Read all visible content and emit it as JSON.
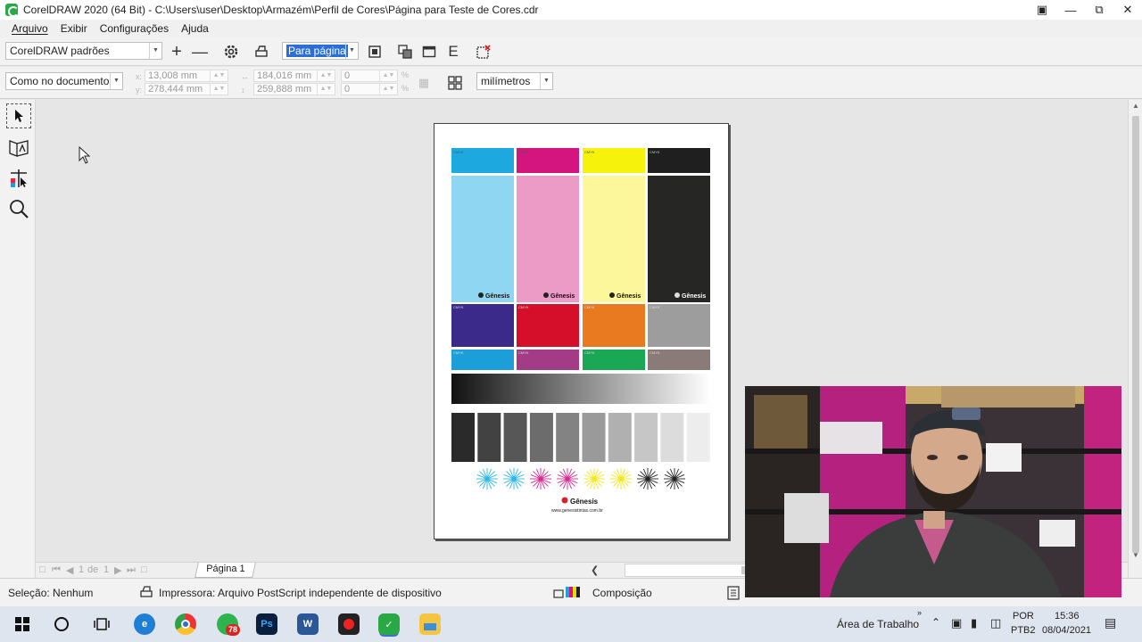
{
  "window": {
    "title": "CorelDRAW 2020 (64 Bit) - C:\\Users\\user\\Desktop\\Armazém\\Perfil de Cores\\Página para Teste de Cores.cdr",
    "controls": [
      "user-icon",
      "minimize-icon",
      "restore-icon",
      "close-icon"
    ]
  },
  "menu": [
    "Arquivo",
    "Exibir",
    "Configurações",
    "Ajuda"
  ],
  "toolbar": {
    "preset": "CorelDRAW padrões",
    "zoom": "Para página"
  },
  "propbar": {
    "document": "Como no documento",
    "x": "13,008 mm",
    "y": "278,444 mm",
    "width": "184,016 mm",
    "height": "259,888 mm",
    "scale_x": "0",
    "scale_y": "0",
    "units": "milímetros"
  },
  "tools": [
    "pick-tool-icon",
    "preview-icon",
    "layout-tool-icon",
    "zoom-tool-icon"
  ],
  "page_preview": {
    "cmyk_label": "CMYK",
    "brand": "Gênesis",
    "website": "www.genesistintas.com.br",
    "tall_strips": [
      {
        "top": "#1ea8e0",
        "body": "#8fd6f2"
      },
      {
        "top": "#d4157f",
        "body": "#ec9ac6"
      },
      {
        "top": "#f7f20c",
        "body": "#fbf79a"
      },
      {
        "top": "#1f1f1f",
        "body": "#262624"
      }
    ],
    "mid_squares": [
      "#3b2a8a",
      "#d50f2a",
      "#ea7a1f",
      "#9d9d9d"
    ],
    "small_squares": [
      "#1c9fd9",
      "#a43b87",
      "#1aa855",
      "#8a7a78"
    ],
    "gray_steps": [
      "#2a2a2a",
      "#424242",
      "#575757",
      "#6c6c6c",
      "#838383",
      "#9a9a9a",
      "#b0b0b0",
      "#c6c6c6",
      "#dcdcdc",
      "#ededed"
    ],
    "starbursts": [
      "#2ab6e6",
      "#2ab6e6",
      "#d52a8e",
      "#d52a8e",
      "#f1e81e",
      "#f1e81e",
      "#222222",
      "#222222"
    ]
  },
  "pagenav": {
    "current": "1",
    "of_label": "de",
    "total": "1",
    "tab": "Página 1"
  },
  "status": {
    "selection": "Seleção: Nenhum",
    "printer": "Impressora: Arquivo PostScript independente de dispositivo",
    "composition": "Composição"
  },
  "taskbar": {
    "desktop_label": "Área de Trabalho",
    "lang1": "POR",
    "lang2": "PTB2",
    "time": "15:36",
    "date": "08/04/2021",
    "badge": "78",
    "apps": [
      "windows-start-icon",
      "search-circle-icon",
      "task-view-icon",
      "edge-icon",
      "chrome-icon",
      "whatsapp-icon",
      "photoshop-icon",
      "word-icon",
      "recorder-icon",
      "coreldraw-icon",
      "file-explorer-icon"
    ]
  }
}
